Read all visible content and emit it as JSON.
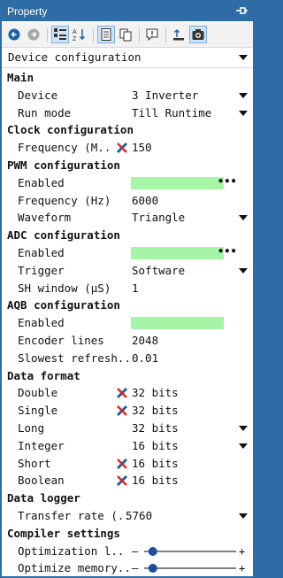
{
  "window": {
    "title": "Property",
    "pin_icon": "pin-icon"
  },
  "toolbar": {
    "buttons": [
      {
        "icon": "back-icon",
        "active": false
      },
      {
        "icon": "forward-icon",
        "active": false
      },
      {
        "icon": "categorized-icon",
        "active": true
      },
      {
        "icon": "alphabetical-sort-icon",
        "active": false
      },
      {
        "icon": "property-pages-icon",
        "active": true
      },
      {
        "icon": "copy-icon",
        "active": false
      },
      {
        "icon": "help-icon",
        "active": false
      },
      {
        "icon": "upload-icon",
        "active": false
      },
      {
        "icon": "camera-icon",
        "active": true
      }
    ]
  },
  "selector": {
    "value": "Device configuration"
  },
  "colors": {
    "titlebar": "#2d6ca5",
    "enabled_fill": "#a6f5a6",
    "slider": "#1b4f9c"
  },
  "sections": {
    "main": {
      "title": "Main",
      "rows": [
        {
          "name": "Device",
          "value": "3 Inverter"
        },
        {
          "name": "Run mode",
          "value": "Till Runtime"
        }
      ]
    },
    "clock": {
      "title": "Clock configuration",
      "rows": [
        {
          "name": "Frequency (M..",
          "value": "150"
        }
      ]
    },
    "pwm": {
      "title": "PWM configuration",
      "rows": [
        {
          "name": "Enabled",
          "value": "•••"
        },
        {
          "name": "Frequency (Hz)",
          "value": "6000"
        },
        {
          "name": "Waveform",
          "value": "Triangle"
        }
      ]
    },
    "adc": {
      "title": "ADC configuration",
      "rows": [
        {
          "name": "Enabled",
          "value": "•••"
        },
        {
          "name": "Trigger",
          "value": "Software"
        },
        {
          "name": "SH window (µS)",
          "value": "1"
        }
      ]
    },
    "aqb": {
      "title": "AQB configuration",
      "rows": [
        {
          "name": "Enabled",
          "value": "•••"
        },
        {
          "name": "Encoder lines",
          "value": "2048"
        },
        {
          "name": "Slowest refresh..",
          "value": "0.01"
        }
      ]
    },
    "data_format": {
      "title": "Data format",
      "rows": [
        {
          "name": "Double",
          "value": "32 bits"
        },
        {
          "name": "Single",
          "value": "32 bits"
        },
        {
          "name": "Long",
          "value": "32 bits"
        },
        {
          "name": "Integer",
          "value": "16 bits"
        },
        {
          "name": "Short",
          "value": "16 bits"
        },
        {
          "name": "Boolean",
          "value": "16 bits"
        }
      ]
    },
    "logger": {
      "title": "Data logger",
      "rows": [
        {
          "name": "Transfer rate (..",
          "value": "5760"
        }
      ]
    },
    "compiler": {
      "title": "Compiler settings",
      "rows": [
        {
          "name": "Optimization l..",
          "minus": "–",
          "plus": "+",
          "level": 0.05
        },
        {
          "name": "Optimize memory..",
          "minus": "–",
          "plus": "+",
          "level": 0.05
        }
      ]
    }
  }
}
